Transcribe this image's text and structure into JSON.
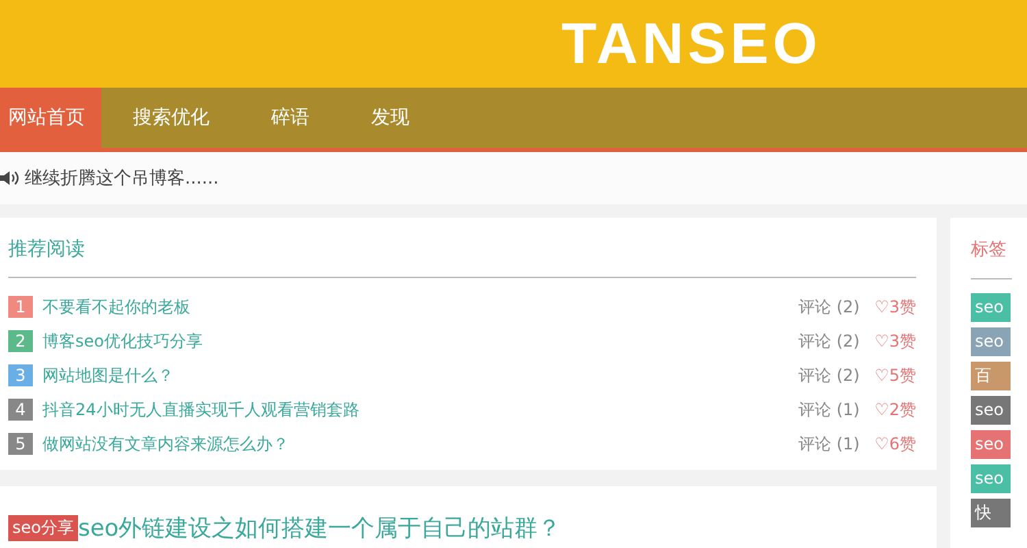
{
  "logo": "TANSEO",
  "nav": [
    {
      "label": "网站首页",
      "selected": true
    },
    {
      "label": "搜索优化",
      "selected": false
    },
    {
      "label": "碎语",
      "selected": false
    },
    {
      "label": "发现",
      "selected": false
    }
  ],
  "notice": "继续折腾这个吊博客......",
  "recommended": {
    "title": "推荐阅读",
    "items": [
      {
        "rank": "1",
        "color": "#f08a80",
        "title": "不要看不起你的老板",
        "comments": "评论 (2)",
        "likes": "♡3赞"
      },
      {
        "rank": "2",
        "color": "#5cb98a",
        "title": "博客seo优化技巧分享",
        "comments": "评论 (2)",
        "likes": "♡3赞"
      },
      {
        "rank": "3",
        "color": "#6aaee6",
        "title": "网站地图是什么？",
        "comments": "评论 (2)",
        "likes": "♡5赞"
      },
      {
        "rank": "4",
        "color": "#888888",
        "title": "抖音24小时无人直播实现千人观看营销套路",
        "comments": "评论 (1)",
        "likes": "♡2赞"
      },
      {
        "rank": "5",
        "color": "#888888",
        "title": "做网站没有文章内容来源怎么办？",
        "comments": "评论 (1)",
        "likes": "♡6赞"
      }
    ]
  },
  "post": {
    "category": "seo分享",
    "title": "seo外链建设之如何搭建一个属于自己的站群？"
  },
  "tags": {
    "title": "标签",
    "items": [
      {
        "label": "seo",
        "color": "#4bbfa6"
      },
      {
        "label": "seo",
        "color": "#8aa3b5"
      },
      {
        "label": "百",
        "color": "#c9986a"
      },
      {
        "label": "seo",
        "color": "#777777"
      },
      {
        "label": "seo",
        "color": "#e57373"
      },
      {
        "label": "seo",
        "color": "#4bbfa6"
      },
      {
        "label": "快",
        "color": "#777777"
      }
    ]
  }
}
